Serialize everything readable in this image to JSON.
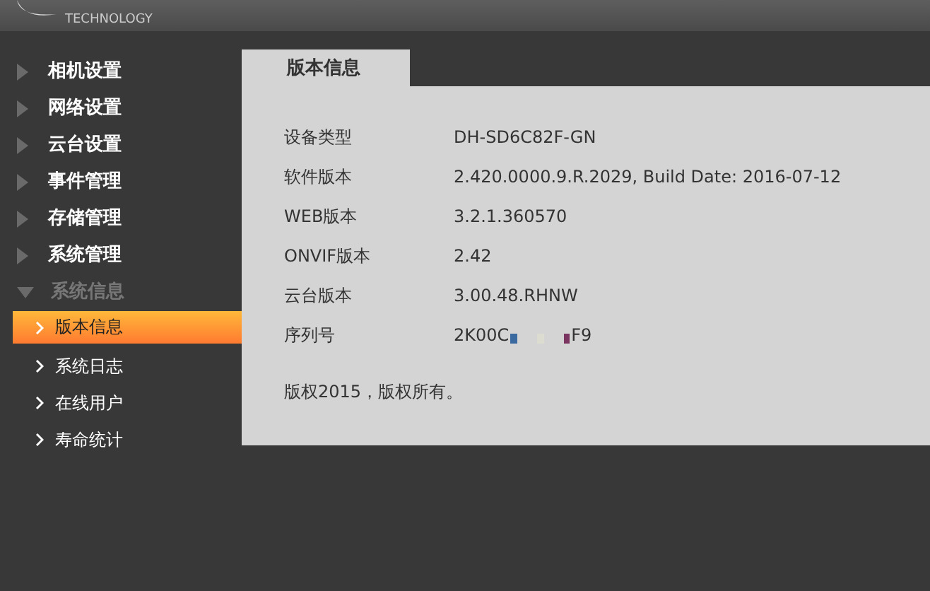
{
  "header": {
    "logo_tagline": "TECHNOLOGY"
  },
  "sidebar": {
    "items": [
      {
        "label": "相机设置",
        "expanded": false
      },
      {
        "label": "网络设置",
        "expanded": false
      },
      {
        "label": "云台设置",
        "expanded": false
      },
      {
        "label": "事件管理",
        "expanded": false
      },
      {
        "label": "存储管理",
        "expanded": false
      },
      {
        "label": "系统管理",
        "expanded": false
      },
      {
        "label": "系统信息",
        "expanded": true,
        "children": [
          {
            "label": "版本信息",
            "selected": true
          },
          {
            "label": "系统日志",
            "selected": false
          },
          {
            "label": "在线用户",
            "selected": false
          },
          {
            "label": "寿命统计",
            "selected": false
          }
        ]
      }
    ]
  },
  "panel": {
    "tab": "版本信息",
    "rows": [
      {
        "label": "设备类型",
        "value": "DH-SD6C82F-GN"
      },
      {
        "label": "软件版本",
        "value": "2.420.0000.9.R.2029, Build Date: 2016-07-12"
      },
      {
        "label": "WEB版本",
        "value": "3.2.1.360570"
      },
      {
        "label": "ONVIF版本",
        "value": "2.42"
      },
      {
        "label": "云台版本",
        "value": "3.00.48.RHNW"
      },
      {
        "label": "序列号",
        "value": "2K00C",
        "value_end": "F9",
        "redacted": true
      }
    ],
    "copyright": "版权2015，版权所有。"
  }
}
